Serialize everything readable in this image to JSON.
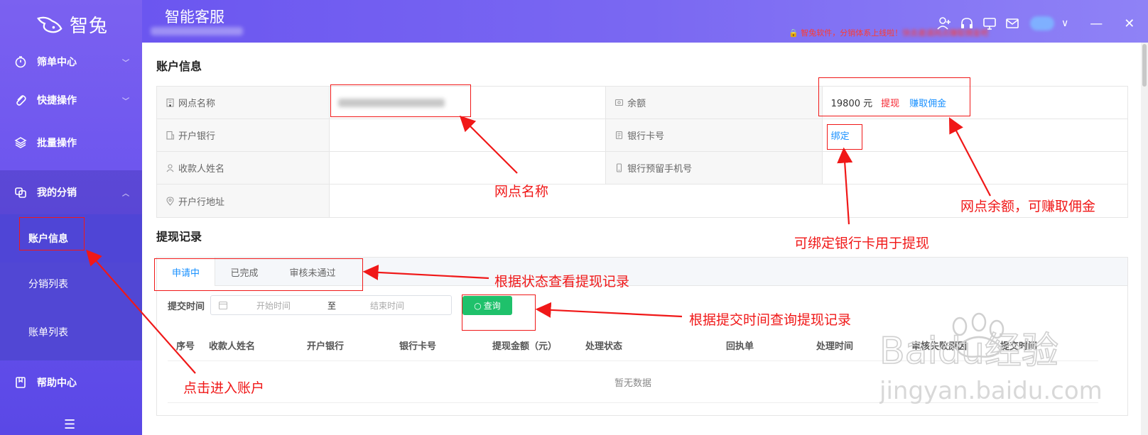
{
  "app": {
    "logo_text": "智兔",
    "title": "智能客服"
  },
  "header": {
    "notice": "智兔软件，分销体系上线啦！快去邀请网点赚取佣金吧",
    "notice_prefix": "智兔软件，分销体系上线啦！",
    "notice_blurred": "快去邀请网点赚取佣金吧"
  },
  "sidebar": {
    "items": [
      {
        "label": "筛单中心",
        "icon": "stopwatch-icon"
      },
      {
        "label": "快捷操作",
        "icon": "paperclip-icon"
      },
      {
        "label": "批量操作",
        "icon": "layers-icon"
      },
      {
        "label": "我的分销",
        "icon": "distribution-icon"
      },
      {
        "label": "帮助中心",
        "icon": "book-icon"
      }
    ],
    "sub_items": [
      {
        "label": "账户信息"
      },
      {
        "label": "分销列表"
      },
      {
        "label": "账单列表"
      }
    ]
  },
  "account": {
    "section_title": "账户信息",
    "rows": [
      {
        "label1": "网点名称",
        "value1": "",
        "label2": "余额",
        "value2": "19800 元"
      },
      {
        "label1": "开户银行",
        "value1": "",
        "label2": "银行卡号",
        "value2": ""
      },
      {
        "label1": "收款人姓名",
        "value1": "",
        "label2": "银行预留手机号",
        "value2": ""
      },
      {
        "label1": "开户行地址",
        "value1": ""
      }
    ],
    "withdraw_link": "提现",
    "earn_link": "赚取佣金",
    "bind_link": "绑定"
  },
  "withdraw": {
    "section_title": "提现记录",
    "tabs": [
      "申请中",
      "已完成",
      "审核未通过"
    ],
    "filter_label": "提交时间",
    "start_placeholder": "开始时间",
    "separator": "至",
    "end_placeholder": "结束时间",
    "query_button": "查询",
    "columns": [
      "序号",
      "收款人姓名",
      "开户银行",
      "银行卡号",
      "提现金额（元）",
      "处理状态",
      "回执单",
      "处理时间",
      "审核失败原因",
      "提交时间"
    ],
    "empty_text": "暂无数据"
  },
  "annotations": {
    "outlet_name": "网点名称",
    "balance": "网点余额，可赚取佣金",
    "bind_card": "可绑定银行卡用于提现",
    "tabs": "根据状态查看提现记录",
    "query": "根据提交时间查询提现记录",
    "enter_account": "点击进入账户"
  },
  "watermark": {
    "brand": "Baidu经验",
    "url": "jingyan.baidu.com"
  },
  "colors": {
    "sidebar": "#6a53ee",
    "header": "#7a68f2",
    "accent_blue": "#1890ff",
    "annotation_red": "#f01818",
    "query_green": "#1fc16b"
  }
}
